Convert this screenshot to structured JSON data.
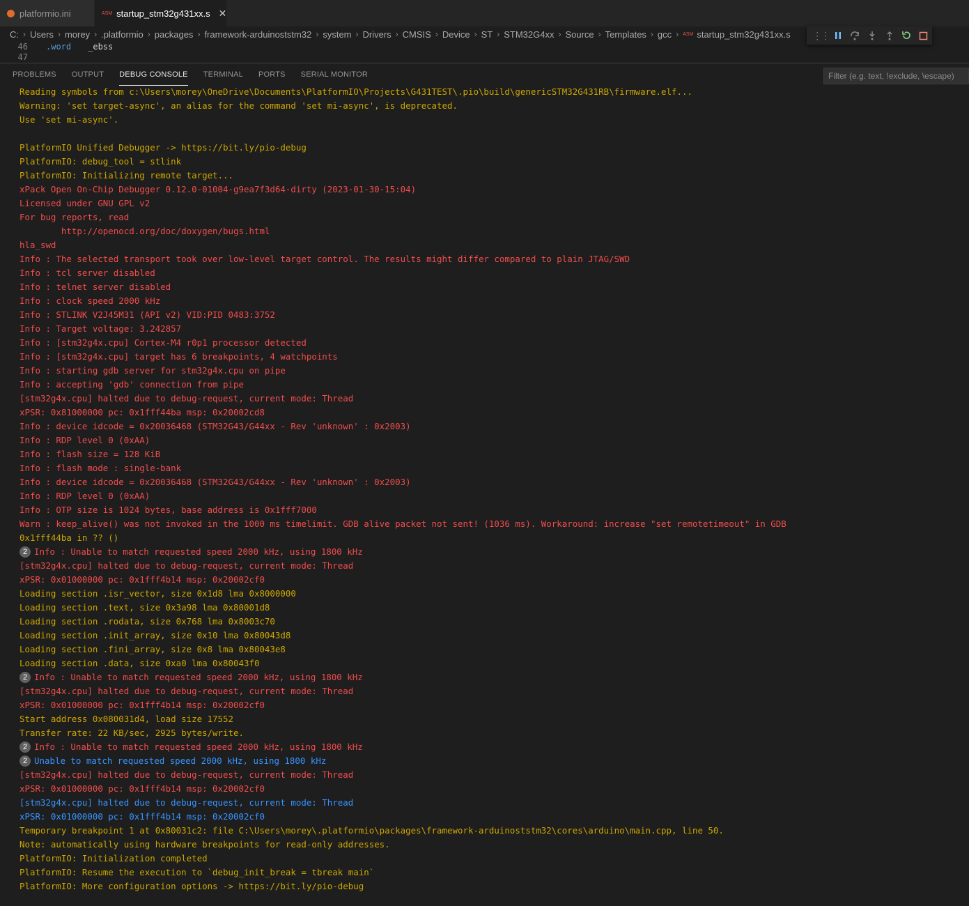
{
  "tabs": [
    {
      "label": "platformio.ini",
      "icon": "platformio-icon",
      "active": false
    },
    {
      "label": "startup_stm32g431xx.s",
      "icon": "asm-file-icon",
      "active": true,
      "close": "✕"
    }
  ],
  "breadcrumb": [
    "C:",
    "Users",
    "morey",
    ".platformio",
    "packages",
    "framework-arduinoststm32",
    "system",
    "Drivers",
    "CMSIS",
    "Device",
    "ST",
    "STM32G4xx",
    "Source",
    "Templates",
    "gcc",
    "startup_stm32g431xx.s"
  ],
  "file_icon_text": "ASM",
  "editor": {
    "lines": [
      {
        "num": "46",
        "keyword": ".word",
        "arg": "_ebss"
      },
      {
        "num": "47",
        "keyword": "",
        "arg": ""
      }
    ]
  },
  "debug_toolbar": [
    "drag-handle",
    "pause",
    "step-over",
    "step-into",
    "step-out",
    "restart",
    "stop"
  ],
  "panel_tabs": [
    "PROBLEMS",
    "OUTPUT",
    "DEBUG CONSOLE",
    "TERMINAL",
    "PORTS",
    "SERIAL MONITOR"
  ],
  "active_panel_tab": "DEBUG CONSOLE",
  "filter_placeholder": "Filter (e.g. text, !exclude, \\escape)",
  "colors": {
    "yellow": "#cca700",
    "red": "#f14c4c",
    "blue": "#3794ff"
  },
  "console": [
    {
      "c": "y",
      "t": "Reading symbols from c:\\Users\\morey\\OneDrive\\Documents\\PlatformIO\\Projects\\G431TEST\\.pio\\build\\genericSTM32G431RB\\firmware.elf..."
    },
    {
      "c": "y",
      "t": "Warning: 'set target-async', an alias for the command 'set mi-async', is deprecated."
    },
    {
      "c": "y",
      "t": "Use 'set mi-async'."
    },
    {
      "c": "y",
      "t": ""
    },
    {
      "c": "y",
      "t": "PlatformIO Unified Debugger -> https://bit.ly/pio-debug"
    },
    {
      "c": "y",
      "t": "PlatformIO: debug_tool = stlink"
    },
    {
      "c": "y",
      "t": "PlatformIO: Initializing remote target..."
    },
    {
      "c": "r",
      "t": "xPack Open On-Chip Debugger 0.12.0-01004-g9ea7f3d64-dirty (2023-01-30-15:04)"
    },
    {
      "c": "r",
      "t": "Licensed under GNU GPL v2"
    },
    {
      "c": "r",
      "t": "For bug reports, read"
    },
    {
      "c": "r",
      "t": "        http://openocd.org/doc/doxygen/bugs.html"
    },
    {
      "c": "r",
      "t": "hla_swd"
    },
    {
      "c": "r",
      "t": "Info : The selected transport took over low-level target control. The results might differ compared to plain JTAG/SWD"
    },
    {
      "c": "r",
      "t": "Info : tcl server disabled"
    },
    {
      "c": "r",
      "t": "Info : telnet server disabled"
    },
    {
      "c": "r",
      "t": "Info : clock speed 2000 kHz"
    },
    {
      "c": "r",
      "t": "Info : STLINK V2J45M31 (API v2) VID:PID 0483:3752"
    },
    {
      "c": "r",
      "t": "Info : Target voltage: 3.242857"
    },
    {
      "c": "r",
      "t": "Info : [stm32g4x.cpu] Cortex-M4 r0p1 processor detected"
    },
    {
      "c": "r",
      "t": "Info : [stm32g4x.cpu] target has 6 breakpoints, 4 watchpoints"
    },
    {
      "c": "r",
      "t": "Info : starting gdb server for stm32g4x.cpu on pipe"
    },
    {
      "c": "r",
      "t": "Info : accepting 'gdb' connection from pipe"
    },
    {
      "c": "r",
      "t": "[stm32g4x.cpu] halted due to debug-request, current mode: Thread"
    },
    {
      "c": "r",
      "t": "xPSR: 0x81000000 pc: 0x1fff44ba msp: 0x20002cd8"
    },
    {
      "c": "r",
      "t": "Info : device idcode = 0x20036468 (STM32G43/G44xx - Rev 'unknown' : 0x2003)"
    },
    {
      "c": "r",
      "t": "Info : RDP level 0 (0xAA)"
    },
    {
      "c": "r",
      "t": "Info : flash size = 128 KiB"
    },
    {
      "c": "r",
      "t": "Info : flash mode : single-bank"
    },
    {
      "c": "r",
      "t": "Info : device idcode = 0x20036468 (STM32G43/G44xx - Rev 'unknown' : 0x2003)"
    },
    {
      "c": "r",
      "t": "Info : RDP level 0 (0xAA)"
    },
    {
      "c": "r",
      "t": "Info : OTP size is 1024 bytes, base address is 0x1fff7000"
    },
    {
      "c": "r",
      "t": "Warn : keep_alive() was not invoked in the 1000 ms timelimit. GDB alive packet not sent! (1036 ms). Workaround: increase \"set remotetimeout\" in GDB"
    },
    {
      "c": "y",
      "t": "0x1fff44ba in ?? ()"
    },
    {
      "c": "r",
      "t": "Info : Unable to match requested speed 2000 kHz, using 1800 kHz",
      "badge": "2"
    },
    {
      "c": "r",
      "t": "[stm32g4x.cpu] halted due to debug-request, current mode: Thread"
    },
    {
      "c": "r",
      "t": "xPSR: 0x01000000 pc: 0x1fff4b14 msp: 0x20002cf0"
    },
    {
      "c": "y",
      "t": "Loading section .isr_vector, size 0x1d8 lma 0x8000000"
    },
    {
      "c": "y",
      "t": "Loading section .text, size 0x3a98 lma 0x80001d8"
    },
    {
      "c": "y",
      "t": "Loading section .rodata, size 0x768 lma 0x8003c70"
    },
    {
      "c": "y",
      "t": "Loading section .init_array, size 0x10 lma 0x80043d8"
    },
    {
      "c": "y",
      "t": "Loading section .fini_array, size 0x8 lma 0x80043e8"
    },
    {
      "c": "y",
      "t": "Loading section .data, size 0xa0 lma 0x80043f0"
    },
    {
      "c": "r",
      "t": "Info : Unable to match requested speed 2000 kHz, using 1800 kHz",
      "badge": "2"
    },
    {
      "c": "r",
      "t": "[stm32g4x.cpu] halted due to debug-request, current mode: Thread"
    },
    {
      "c": "r",
      "t": "xPSR: 0x01000000 pc: 0x1fff4b14 msp: 0x20002cf0"
    },
    {
      "c": "y",
      "t": "Start address 0x080031d4, load size 17552"
    },
    {
      "c": "y",
      "t": "Transfer rate: 22 KB/sec, 2925 bytes/write."
    },
    {
      "c": "r",
      "t": "Info : Unable to match requested speed 2000 kHz, using 1800 kHz",
      "badge": "2"
    },
    {
      "c": "b",
      "t": "Unable to match requested speed 2000 kHz, using 1800 kHz",
      "badge": "2"
    },
    {
      "c": "r",
      "t": "[stm32g4x.cpu] halted due to debug-request, current mode: Thread"
    },
    {
      "c": "r",
      "t": "xPSR: 0x01000000 pc: 0x1fff4b14 msp: 0x20002cf0"
    },
    {
      "c": "b",
      "t": "[stm32g4x.cpu] halted due to debug-request, current mode: Thread"
    },
    {
      "c": "b",
      "t": "xPSR: 0x01000000 pc: 0x1fff4b14 msp: 0x20002cf0"
    },
    {
      "c": "y",
      "t": "Temporary breakpoint 1 at 0x80031c2: file C:\\Users\\morey\\.platformio\\packages\\framework-arduinoststm32\\cores\\arduino\\main.cpp, line 50."
    },
    {
      "c": "y",
      "t": "Note: automatically using hardware breakpoints for read-only addresses."
    },
    {
      "c": "y",
      "t": "PlatformIO: Initialization completed"
    },
    {
      "c": "y",
      "t": "PlatformIO: Resume the execution to `debug_init_break = tbreak main`"
    },
    {
      "c": "y",
      "t": "PlatformIO: More configuration options -> https://bit.ly/pio-debug"
    }
  ]
}
